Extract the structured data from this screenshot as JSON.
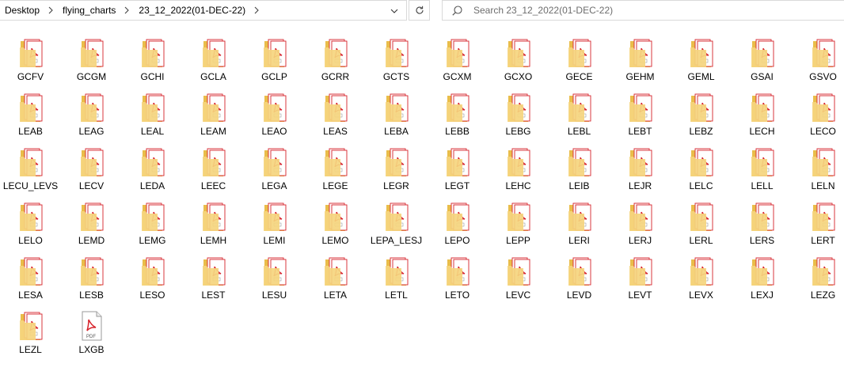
{
  "address": {
    "crumbs": [
      "Desktop",
      "flying_charts",
      "23_12_2022(01-DEC-22)"
    ]
  },
  "search": {
    "placeholder": "Search 23_12_2022(01-DEC-22)"
  },
  "colors": {
    "folder": "#f5d57e",
    "folder_dark": "#e9bd4a",
    "pdf_red": "#d6222a"
  },
  "icons": {
    "item": "pdf-in-folder-icon",
    "single": "pdf-file-icon"
  },
  "files": [
    {
      "name": "GCFV"
    },
    {
      "name": "GCGM"
    },
    {
      "name": "GCHI"
    },
    {
      "name": "GCLA"
    },
    {
      "name": "GCLP"
    },
    {
      "name": "GCRR"
    },
    {
      "name": "GCTS"
    },
    {
      "name": "GCXM"
    },
    {
      "name": "GCXO"
    },
    {
      "name": "GECE"
    },
    {
      "name": "GEHM"
    },
    {
      "name": "GEML"
    },
    {
      "name": "GSAI"
    },
    {
      "name": "GSVO"
    },
    {
      "name": "LEAB"
    },
    {
      "name": "LEAG"
    },
    {
      "name": "LEAL"
    },
    {
      "name": "LEAM"
    },
    {
      "name": "LEAO"
    },
    {
      "name": "LEAS"
    },
    {
      "name": "LEBA"
    },
    {
      "name": "LEBB"
    },
    {
      "name": "LEBG"
    },
    {
      "name": "LEBL"
    },
    {
      "name": "LEBT"
    },
    {
      "name": "LEBZ"
    },
    {
      "name": "LECH"
    },
    {
      "name": "LECO"
    },
    {
      "name": "LECU_LEVS"
    },
    {
      "name": "LECV"
    },
    {
      "name": "LEDA"
    },
    {
      "name": "LEEC"
    },
    {
      "name": "LEGA"
    },
    {
      "name": "LEGE"
    },
    {
      "name": "LEGR"
    },
    {
      "name": "LEGT"
    },
    {
      "name": "LEHC"
    },
    {
      "name": "LEIB"
    },
    {
      "name": "LEJR"
    },
    {
      "name": "LELC"
    },
    {
      "name": "LELL"
    },
    {
      "name": "LELN"
    },
    {
      "name": "LELO"
    },
    {
      "name": "LEMD"
    },
    {
      "name": "LEMG"
    },
    {
      "name": "LEMH"
    },
    {
      "name": "LEMI"
    },
    {
      "name": "LEMO"
    },
    {
      "name": "LEPA_LESJ"
    },
    {
      "name": "LEPO"
    },
    {
      "name": "LEPP"
    },
    {
      "name": "LERI"
    },
    {
      "name": "LERJ"
    },
    {
      "name": "LERL"
    },
    {
      "name": "LERS"
    },
    {
      "name": "LERT"
    },
    {
      "name": "LESA"
    },
    {
      "name": "LESB"
    },
    {
      "name": "LESO"
    },
    {
      "name": "LEST"
    },
    {
      "name": "LESU"
    },
    {
      "name": "LETA"
    },
    {
      "name": "LETL"
    },
    {
      "name": "LETO"
    },
    {
      "name": "LEVC"
    },
    {
      "name": "LEVD"
    },
    {
      "name": "LEVT"
    },
    {
      "name": "LEVX"
    },
    {
      "name": "LEXJ"
    },
    {
      "name": "LEZG"
    },
    {
      "name": "LEZL"
    },
    {
      "name": "LXGB",
      "single": true
    }
  ]
}
